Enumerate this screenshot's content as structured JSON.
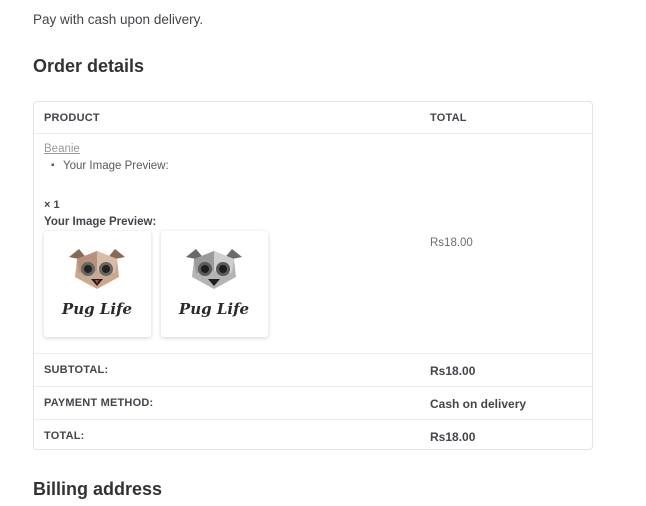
{
  "intro_text": "Pay with cash upon delivery.",
  "order_details_heading": "Order details",
  "billing_heading": "Billing address",
  "table": {
    "headers": {
      "product": "PRODUCT",
      "total": "TOTAL"
    },
    "item": {
      "name": "Beanie",
      "bullet": "Your Image Preview:",
      "quantity": "× 1",
      "preview_label": "Your Image Preview:",
      "price": "Rs18.00",
      "thumbnails": [
        {
          "caption": "Pug Life",
          "tint": "color"
        },
        {
          "caption": "Pug Life",
          "tint": "grayscale"
        }
      ]
    },
    "subtotal": {
      "label": "SUBTOTAL:",
      "value": "Rs18.00"
    },
    "payment_method": {
      "label": "PAYMENT METHOD:",
      "value": "Cash on delivery"
    },
    "total": {
      "label": "TOTAL:",
      "value": "Rs18.00"
    }
  }
}
